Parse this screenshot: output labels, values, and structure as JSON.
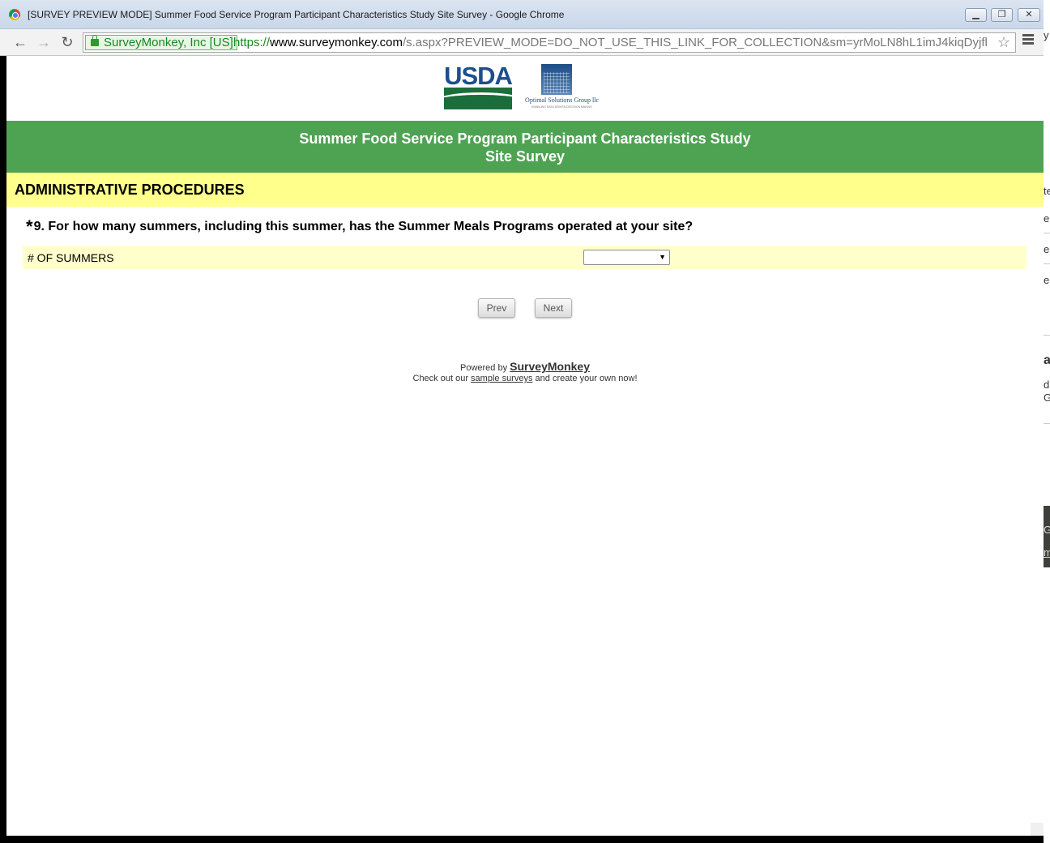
{
  "window": {
    "title": "[SURVEY PREVIEW MODE] Summer Food Service Program Participant Characteristics Study Site Survey - Google Chrome",
    "minimize": "▁",
    "restore": "❐",
    "close": "✕"
  },
  "toolbar": {
    "back_icon": "arrow-left-icon",
    "forward_icon": "arrow-right-icon",
    "reload_icon": "reload-icon",
    "ev_cert": "SurveyMonkey, Inc [US]",
    "url_scheme": "https://",
    "url_host": "www.surveymonkey.com",
    "url_path": "/s.aspx?PREVIEW_MODE=DO_NOT_USE_THIS_LINK_FOR_COLLECTION&sm=yrMoLN8hL1imJ4kiqDyjfl"
  },
  "logos": {
    "usda": "USDA",
    "osg_name": "Optimal Solutions Group llc",
    "osg_tagline": "ENABLING DATA-DRIVEN DECISION MAKING"
  },
  "survey": {
    "title_line1": "Summer Food Service Program Participant Characteristics Study",
    "title_line2": "Site Survey",
    "section": "ADMINISTRATIVE PROCEDURES",
    "required_mark": "*",
    "question": "9. For how many summers, including this summer, has the Summer Meals Programs operated at your site?",
    "answer_label": "# OF SUMMERS",
    "select_value": "",
    "prev_label": "Prev",
    "next_label": "Next"
  },
  "footer": {
    "powered_by": "Powered by",
    "brand": "SurveyMonkey",
    "checkout_pre": "Check out our",
    "checkout_link": "sample surveys",
    "checkout_post": "and create your own now!"
  },
  "background_window": {
    "fragments": [
      "y",
      "te",
      "er",
      "er",
      "er",
      "a",
      "d",
      "G",
      "G",
      "m"
    ]
  },
  "colors": {
    "banner_green": "#4ea352",
    "section_yellow": "#ffff8c",
    "answer_row": "#ffffcc",
    "ev_green": "#16891e"
  }
}
